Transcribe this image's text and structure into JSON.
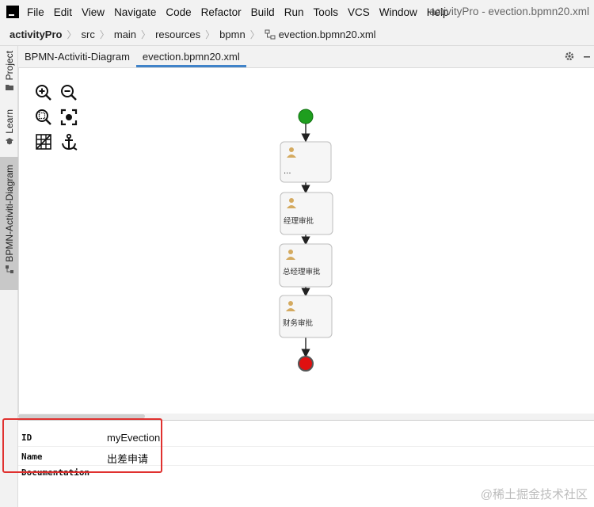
{
  "menubar": {
    "items": [
      "File",
      "Edit",
      "View",
      "Navigate",
      "Code",
      "Refactor",
      "Build",
      "Run",
      "Tools",
      "VCS",
      "Window",
      "Help"
    ],
    "window_title": "activityPro - evection.bpmn20.xml"
  },
  "breadcrumb": {
    "items": [
      "activityPro",
      "src",
      "main",
      "resources",
      "bpmn",
      "evection.bpmn20.xml"
    ]
  },
  "left_strip": {
    "tabs": [
      "Project",
      "Learn",
      "BPMN-Activiti-Diagram"
    ]
  },
  "editor_tabs": [
    "BPMN-Activiti-Diagram",
    "evection.bpmn20.xml"
  ],
  "diagram": {
    "tasks": [
      "...",
      "经理审批",
      "总经理审批",
      "财务审批"
    ],
    "colors": {
      "start_event": "#1e9e1e",
      "end_event": "#e01010",
      "user_icon": "#d4aa60",
      "task_border": "#bdbdbd"
    }
  },
  "properties": {
    "rows": [
      {
        "key": "ID",
        "value": "myEvection"
      },
      {
        "key": "Name",
        "value": "出差申请"
      },
      {
        "key": "Documentation",
        "value": ""
      }
    ]
  },
  "watermark": "@稀土掘金技术社区",
  "colors": {
    "accent": "#4083c9",
    "highlight": "#e0312f"
  }
}
